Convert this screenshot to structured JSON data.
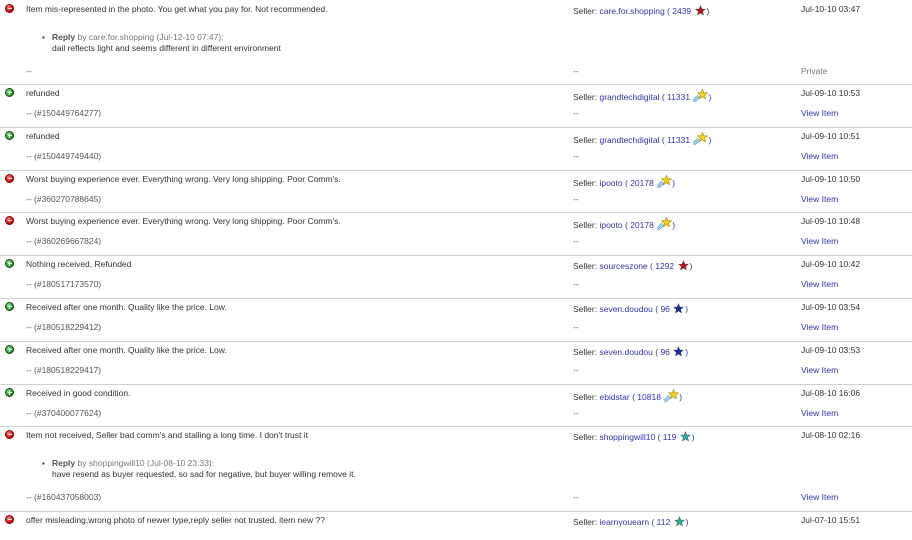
{
  "colors": {
    "negative": "#cc0000",
    "positive": "#1f8f1f",
    "link": "#3333aa",
    "separator": "#cfcfcf"
  },
  "labels": {
    "seller": "Seller:",
    "dash": "--",
    "reply": "Reply",
    "by": "by"
  },
  "rows": [
    {
      "type": "negative",
      "comment": "Item mis-represented in the photo. You get what you pay for. Not recommended.",
      "seller": "care.for.shopping",
      "score": "2439",
      "star": "red-star-icon",
      "date": "Jul-10-10 03:47",
      "item": "--",
      "action": "Private",
      "reply": {
        "by": "care.for.shopping",
        "date": "(Jul-12-10 07:47):",
        "text": "dail reflects light and seems different in different environment"
      }
    },
    {
      "type": "positive",
      "comment": "refunded",
      "seller": "grandtechdigital",
      "score": "11331",
      "star": "shooting-star-icon",
      "date": "Jul-09-10 10:53",
      "item": "-- (#150449764277)",
      "action": "View Item"
    },
    {
      "type": "positive",
      "comment": "refunded",
      "seller": "grandtechdigital",
      "score": "11331",
      "star": "shooting-star-icon",
      "date": "Jul-09-10 10:51",
      "item": "-- (#150449749440)",
      "action": "View Item"
    },
    {
      "type": "negative",
      "comment": "Worst buying experience ever. Everything wrong. Very long shipping. Poor Comm's.",
      "seller": "ipooto",
      "score": "20178",
      "star": "shooting-star-icon",
      "date": "Jul-09-10 10:50",
      "item": "-- (#360270788645)",
      "action": "View Item"
    },
    {
      "type": "negative",
      "comment": "Worst buying experience ever. Everything wrong. Very long shipping. Poor Comm's.",
      "seller": "ipooto",
      "score": "20178",
      "star": "shooting-star-icon",
      "date": "Jul-09-10 10:48",
      "item": "-- (#360269667824)",
      "action": "View Item"
    },
    {
      "type": "positive",
      "comment": "Nothing received, Refunded",
      "seller": "sourceszone",
      "score": "1292",
      "star": "red-star-icon",
      "date": "Jul-09-10 10:42",
      "item": "-- (#180517173570)",
      "action": "View Item"
    },
    {
      "type": "positive",
      "comment": "Received after one month. Quality like the price. Low.",
      "seller": "seven.doudou",
      "score": "96",
      "star": "blue-star-icon",
      "date": "Jul-09-10 03:54",
      "item": "-- (#180518229412)",
      "action": "View Item"
    },
    {
      "type": "positive",
      "comment": "Received after one month. Quality like the price. Low.",
      "seller": "seven.doudou",
      "score": "96",
      "star": "blue-star-icon",
      "date": "Jul-09-10 03:53",
      "item": "-- (#180518229417)",
      "action": "View Item"
    },
    {
      "type": "positive",
      "comment": "Received in good condition.",
      "seller": "ebidstar",
      "score": "10818",
      "star": "shooting-star-icon",
      "date": "Jul-08-10 16:06",
      "item": "-- (#370400077624)",
      "action": "View Item"
    },
    {
      "type": "negative",
      "comment": "Item not received, Seller bad comm's and stalling a long time. I don't trust it",
      "seller": "shoppingwill10",
      "score": "119",
      "star": "turquoise-star-icon",
      "date": "Jul-08-10 02:16",
      "item": "-- (#160437058003)",
      "action": "View Item",
      "reply": {
        "by": "shoppingwill10",
        "date": "(Jul-08-10 23:33):",
        "text": "have resend as buyer requested, so sad for negative, but buyer willing remove it."
      }
    },
    {
      "type": "negative",
      "comment": "offer misleading,wrong photo of newer type,reply seller not trusted. item new ??",
      "seller": "iearnyouearn",
      "score": "112",
      "star": "turquoise-star-icon",
      "date": "Jul-07-10 15:51",
      "item": "",
      "action": ""
    }
  ]
}
